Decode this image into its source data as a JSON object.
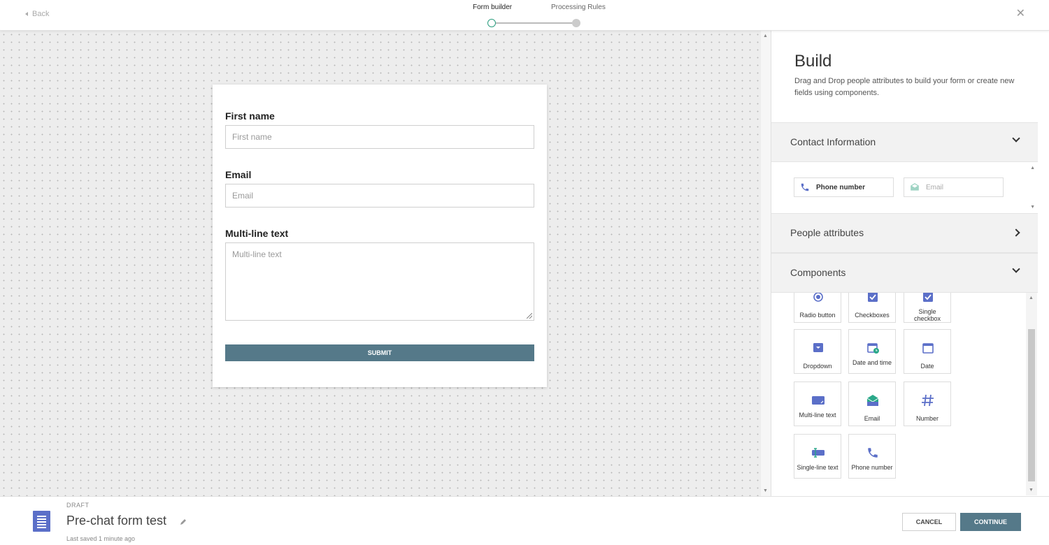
{
  "header": {
    "back_label": "Back",
    "steps": [
      {
        "label": "Form builder",
        "active": true
      },
      {
        "label": "Processing Rules",
        "active": false
      }
    ],
    "close_glyph": "✕"
  },
  "form": {
    "fields": [
      {
        "label": "First name",
        "placeholder": "First name"
      },
      {
        "label": "Email",
        "placeholder": "Email"
      },
      {
        "label": "Multi-line text",
        "placeholder": "Multi-line text"
      }
    ],
    "submit_label": "SUBMIT"
  },
  "panel": {
    "title": "Build",
    "description": "Drag and Drop people attributes to build your form or create new fields using components.",
    "sections": {
      "contact": {
        "title": "Contact Information",
        "items": [
          {
            "label": "Phone number",
            "icon": "phone-icon"
          },
          {
            "label": "Email",
            "icon": "envelope-icon"
          }
        ]
      },
      "people": {
        "title": "People attributes"
      },
      "components": {
        "title": "Components",
        "items": [
          {
            "label": "Radio button",
            "icon": "radio-icon"
          },
          {
            "label": "Checkboxes",
            "icon": "checkbox-icon"
          },
          {
            "label": "Single checkbox",
            "icon": "checkbox-icon"
          },
          {
            "label": "Dropdown",
            "icon": "dropdown-icon"
          },
          {
            "label": "Date and time",
            "icon": "date-time-icon"
          },
          {
            "label": "Date",
            "icon": "calendar-icon"
          },
          {
            "label": "Multi-line text",
            "icon": "multiline-icon"
          },
          {
            "label": "Email",
            "icon": "envelope-icon"
          },
          {
            "label": "Number",
            "icon": "hash-icon"
          },
          {
            "label": "Single-line text",
            "icon": "text-field-icon"
          },
          {
            "label": "Phone number",
            "icon": "phone-icon"
          }
        ]
      }
    }
  },
  "footer": {
    "status": "DRAFT",
    "form_name": "Pre-chat form test",
    "last_saved": "Last saved 1 minute ago",
    "cancel_label": "CANCEL",
    "continue_label": "CONTINUE"
  },
  "colors": {
    "accent": "#557989",
    "step_active": "#2a9d7e",
    "icon_blue": "#5b6fc8",
    "icon_green": "#2aa889"
  }
}
